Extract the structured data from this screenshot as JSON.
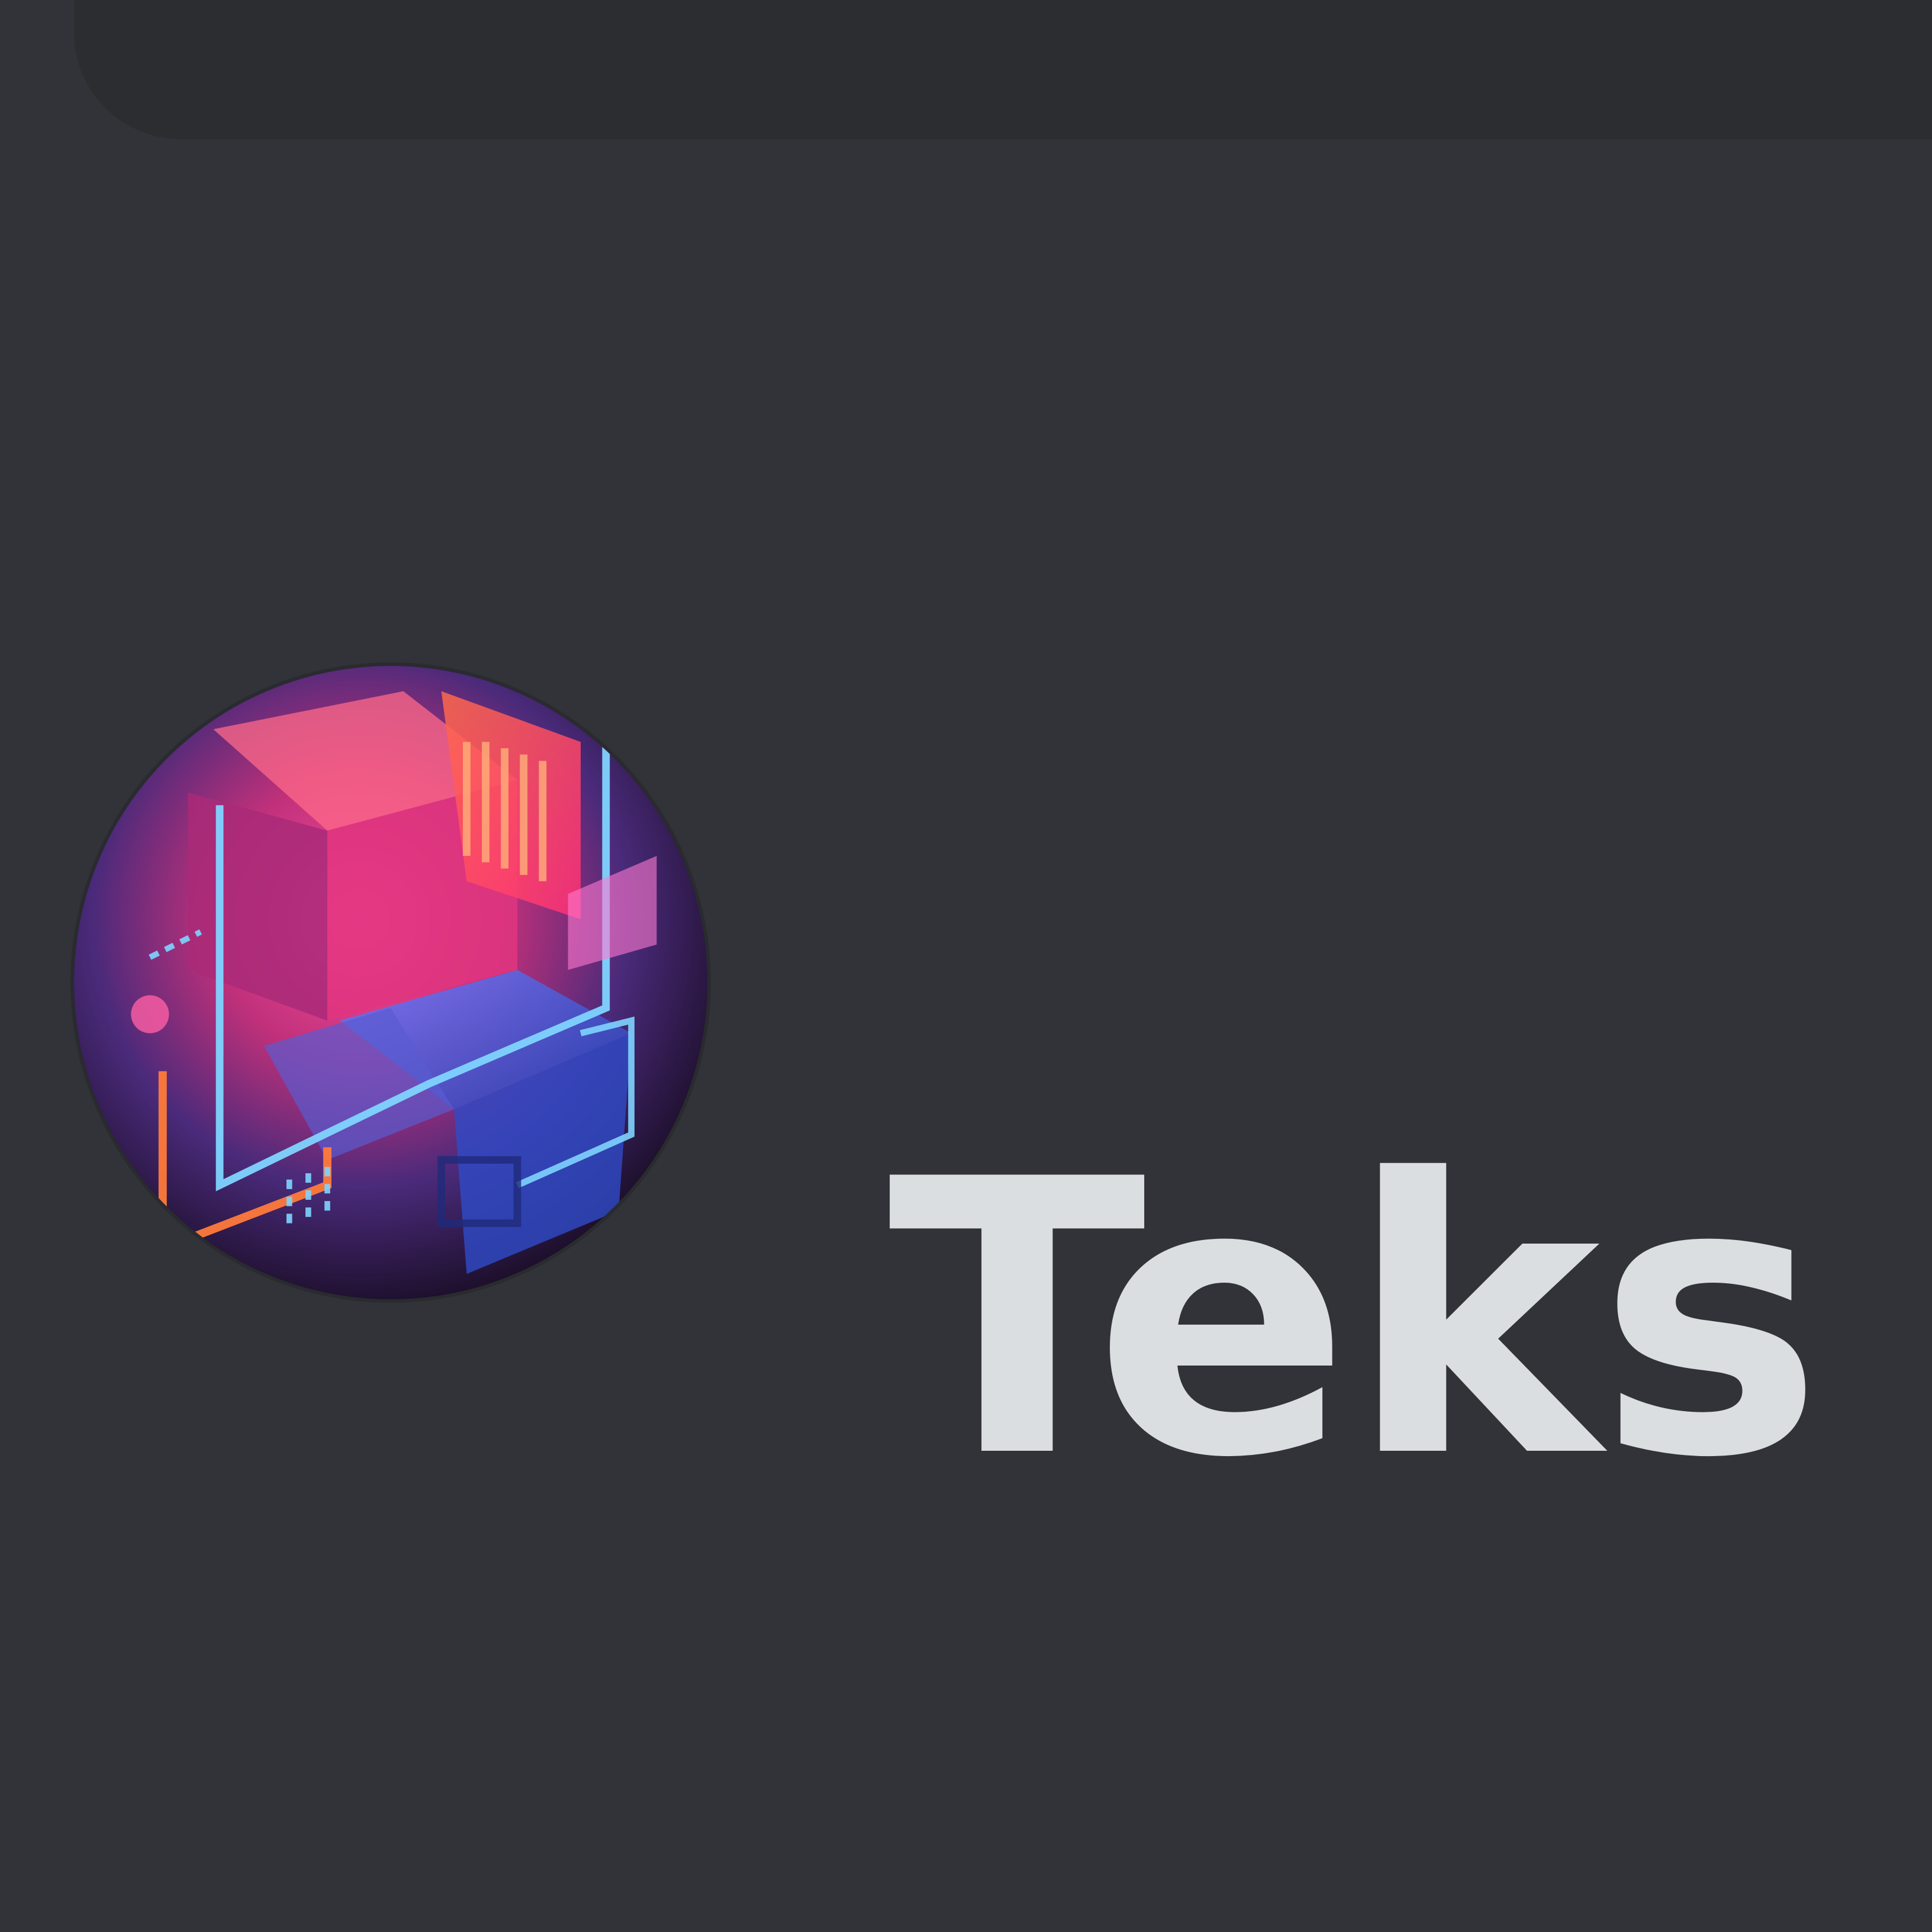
{
  "user": {
    "display_name": "Teks",
    "avatar_icon": "neon-cube-avatar-icon"
  },
  "colors": {
    "background": "#313338",
    "top_bar": "#2b2d31",
    "username_text": "#dbdee1"
  }
}
